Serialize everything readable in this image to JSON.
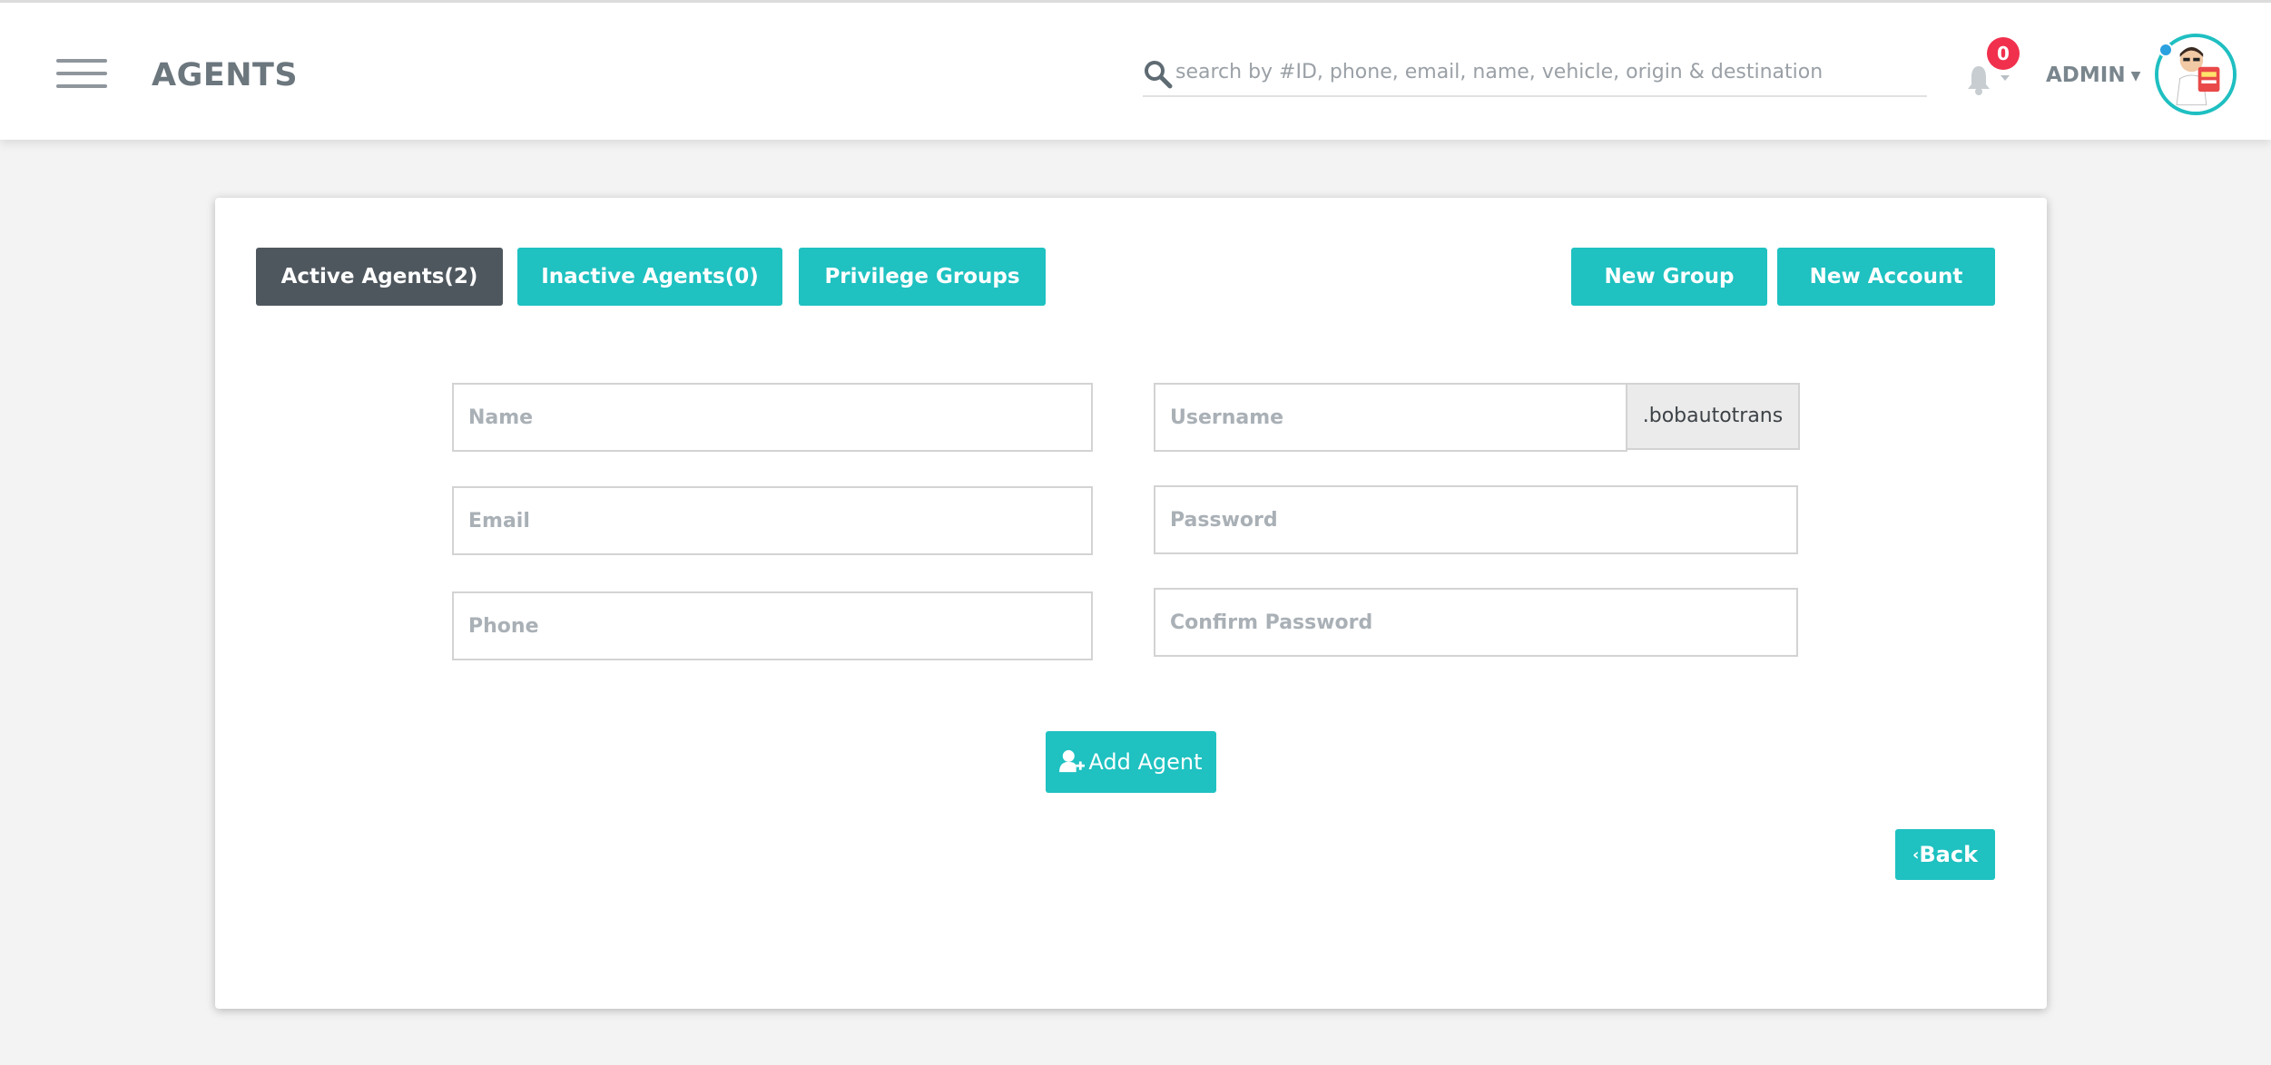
{
  "header": {
    "title": "AGENTS",
    "search_placeholder": "search by #ID, phone, email, name, vehicle, origin & destination",
    "notification_count": "0",
    "user_label": "ADMIN"
  },
  "tabs": {
    "active": "Active Agents(2)",
    "inactive": "Inactive Agents(0)",
    "groups": "Privilege Groups"
  },
  "actions": {
    "new_group": "New Group",
    "new_account": "New Account"
  },
  "form": {
    "name_placeholder": "Name",
    "email_placeholder": "Email",
    "phone_placeholder": "Phone",
    "username_placeholder": "Username",
    "username_suffix": ".bobautotrans",
    "password_placeholder": "Password",
    "confirm_password_placeholder": "Confirm Password",
    "submit_label": "Add Agent",
    "back_label": "Back"
  },
  "colors": {
    "accent": "#1fc1c1",
    "dark_button": "#4f575e",
    "badge": "#f0304d",
    "background": "#f3f3f3"
  },
  "icons": [
    "menu-icon",
    "search-icon",
    "bell-icon",
    "user-plus-icon",
    "chevron-left-icon"
  ]
}
